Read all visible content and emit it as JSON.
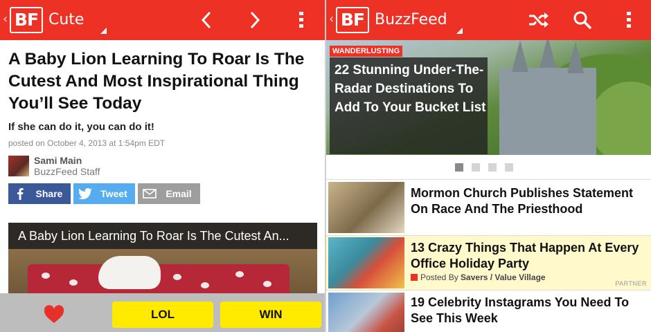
{
  "left": {
    "appbar": {
      "logo": "BF",
      "title": "Cute",
      "icons": [
        "back-caret-icon",
        "chevron-left-icon",
        "chevron-right-icon",
        "overflow-menu-icon"
      ]
    },
    "article": {
      "headline": "A Baby Lion Learning To Roar Is The Cutest And Most Inspirational Thing You’ll See Today",
      "subhead": "If she can do it, you can do it!",
      "posted": "posted on October 4, 2013 at 1:54pm EDT",
      "author_name": "Sami Main",
      "author_role": "BuzzFeed Staff"
    },
    "share": {
      "facebook": "Share",
      "twitter": "Tweet",
      "email": "Email"
    },
    "video": {
      "title": "A Baby Lion Learning To Roar Is The Cutest An..."
    },
    "bottom": {
      "lol": "LOL",
      "win": "WIN"
    },
    "colors": {
      "brand_red": "#ed3124",
      "facebook": "#3b5998",
      "twitter": "#55acee",
      "email": "#9e9e9e",
      "vote_yellow": "#ffea00"
    }
  },
  "right": {
    "appbar": {
      "logo": "BF",
      "title": "BuzzFeed",
      "icons": [
        "back-caret-icon",
        "shuffle-icon",
        "search-icon",
        "overflow-menu-icon"
      ]
    },
    "hero": {
      "tag": "WANDERLUSTING",
      "title": "22 Stunning Under-The-Radar Destinations To Add To Your Bucket List",
      "page_index": 1,
      "page_count": 4
    },
    "feed": [
      {
        "title": "Mormon Church Publishes Statement On Race And The Priesthood"
      },
      {
        "title": "13 Crazy Things That Happen At Every Office Holiday Party",
        "posted_by_prefix": "Posted By",
        "sponsor": "Savers / Value Village",
        "badge": "PARTNER"
      },
      {
        "title": "19 Celebrity Instagrams You Need To See This Week"
      }
    ]
  }
}
